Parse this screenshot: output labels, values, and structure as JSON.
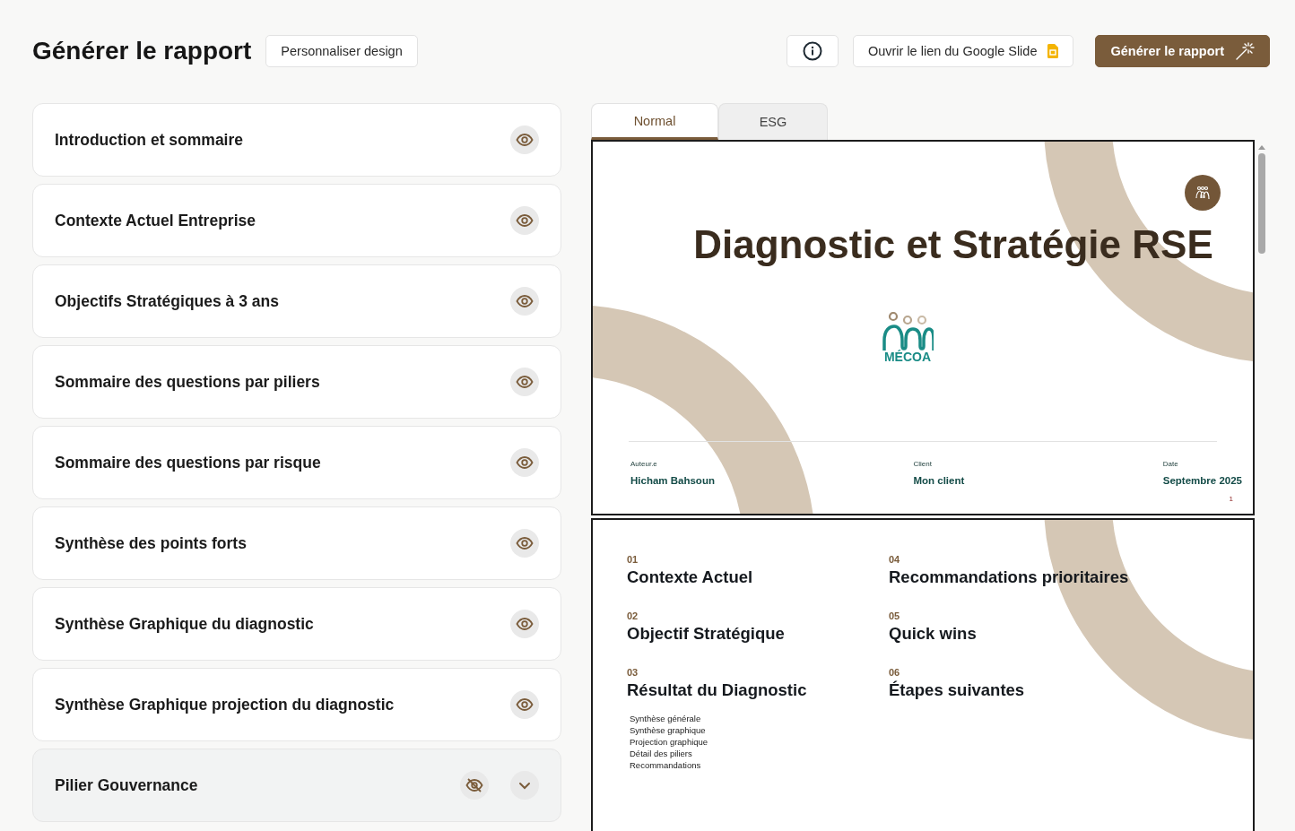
{
  "header": {
    "title": "Générer le rapport",
    "design_button": "Personnaliser design",
    "slide_link_button": "Ouvrir le lien du Google Slide",
    "generate_button": "Générer le rapport"
  },
  "sections": [
    {
      "title": "Introduction et sommaire",
      "visible": true,
      "kind": "section"
    },
    {
      "title": "Contexte Actuel Entreprise",
      "visible": true,
      "kind": "section"
    },
    {
      "title": "Objectifs Stratégiques à 3 ans",
      "visible": true,
      "kind": "section"
    },
    {
      "title": "Sommaire des questions par piliers",
      "visible": true,
      "kind": "section"
    },
    {
      "title": "Sommaire des questions par risque",
      "visible": true,
      "kind": "section"
    },
    {
      "title": "Synthèse des points forts",
      "visible": true,
      "kind": "section"
    },
    {
      "title": "Synthèse Graphique du diagnostic",
      "visible": true,
      "kind": "section"
    },
    {
      "title": "Synthèse Graphique projection du diagnostic",
      "visible": true,
      "kind": "section"
    },
    {
      "title": "Pilier Gouvernance",
      "visible": false,
      "kind": "group",
      "expanded": false
    }
  ],
  "tabs": [
    {
      "label": "Normal",
      "selected": true
    },
    {
      "label": "ESG",
      "selected": false
    }
  ],
  "cover_slide": {
    "title": "Diagnostic et Stratégie RSE",
    "logo_text": "MÉCOA",
    "meta": [
      {
        "label": "Auteur.e",
        "value": "Hicham Bahsoun"
      },
      {
        "label": "Client",
        "value": "Mon client"
      },
      {
        "label": "Date",
        "value": "Septembre 2025"
      }
    ],
    "page_number": "1"
  },
  "toc_slide": {
    "columns": [
      [
        {
          "number": "01",
          "title": "Contexte Actuel"
        },
        {
          "number": "02",
          "title": "Objectif Stratégique"
        },
        {
          "number": "03",
          "title": "Résultat du Diagnostic",
          "subitems": [
            "Synthèse générale",
            "Synthèse graphique",
            "Projection graphique",
            "Détail des piliers",
            "Recommandations"
          ]
        }
      ],
      [
        {
          "number": "04",
          "title": "Recommandations prioritaires"
        },
        {
          "number": "05",
          "title": "Quick wins"
        },
        {
          "number": "06",
          "title": "Étapes suivantes"
        }
      ]
    ]
  }
}
